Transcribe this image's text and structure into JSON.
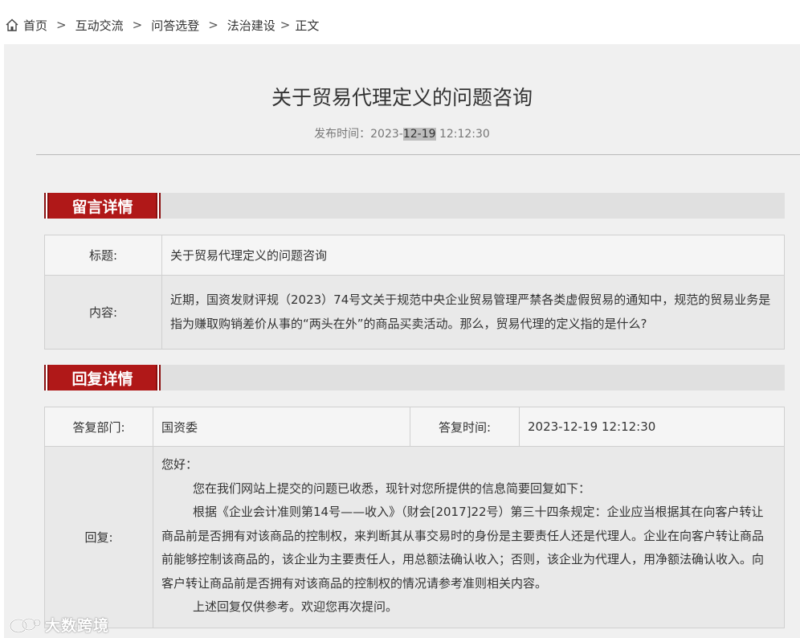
{
  "breadcrumb": {
    "home": "首页",
    "items": [
      "互动交流",
      "问答选登",
      "法治建设"
    ],
    "current": "正文",
    "separator": ">"
  },
  "article": {
    "title": "关于贸易代理定义的问题咨询",
    "publish_label": "发布时间：",
    "publish_pre": "2023-",
    "publish_highlight": "12-19",
    "publish_post": " 12:12:30"
  },
  "message_section": {
    "heading": "留言详情",
    "title_label": "标题:",
    "title_value": "关于贸易代理定义的问题咨询",
    "content_label": "内容:",
    "content_value": "近期，国资发财评规（2023）74号文关于规范中央企业贸易管理严禁各类虚假贸易的通知中，规范的贸易业务是指为赚取购销差价从事的“两头在外”的商品买卖活动。那么，贸易代理的定义指的是什么?"
  },
  "reply_section": {
    "heading": "回复详情",
    "dept_label": "答复部门:",
    "dept_value": "国资委",
    "time_label": "答复时间:",
    "time_value": "2023-12-19 12:12:30",
    "reply_label": "回复:",
    "reply_greeting": "您好：",
    "reply_p1": "您在我们网站上提交的问题已收悉，现针对您所提供的信息简要回复如下：",
    "reply_p2": "根据《企业会计准则第14号——收入》（财会[2017]22号）第三十四条规定：企业应当根据其在向客户转让商品前是否拥有对该商品的控制权，来判断其从事交易时的身份是主要责任人还是代理人。企业在向客户转让商品前能够控制该商品的，该企业为主要责任人，用总额法确认收入；否则，该企业为代理人，用净额法确认收入。向客户转让商品前是否拥有对该商品的控制权的情况请参考准则相关内容。",
    "reply_p3": "上述回复仅供参考。欢迎您再次提问。"
  },
  "watermark": {
    "text": "大数跨境",
    "icon": "wechat-logo-icon"
  },
  "colors": {
    "accent": "#b01818",
    "panel": "#f0f0f0",
    "section_bar": "#e0e0e0"
  }
}
